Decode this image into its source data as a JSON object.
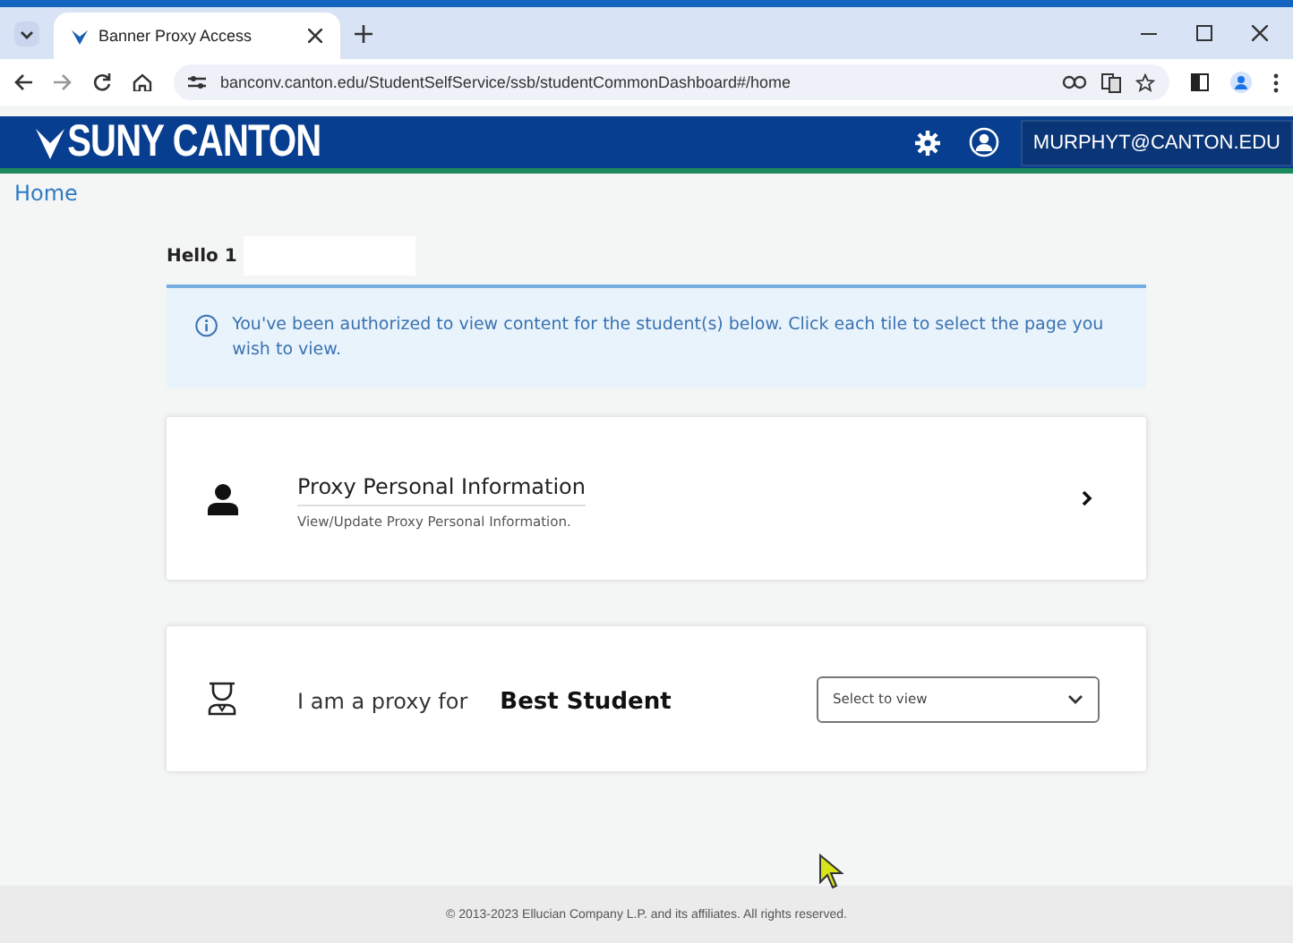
{
  "browser": {
    "tabs": [
      {
        "title": "Banner Proxy Access",
        "selected": true
      }
    ],
    "url": "banconv.canton.edu/StudentSelfService/ssb/studentCommonDashboard#/home"
  },
  "header": {
    "logo": "SUNY CANTON",
    "user": "MURPHYT@CANTON.EDU"
  },
  "breadcrumb": "Home",
  "greeting": "Hello 1",
  "notice": "You've been authorized to view content for the student(s) below. Click each tile to select the page you wish to view.",
  "tiles": [
    {
      "kind": "link",
      "title": "Proxy Personal Information",
      "description": "View/Update Proxy Personal Information."
    },
    {
      "kind": "proxy",
      "label": "I am a proxy for",
      "student": "Best Student",
      "select": {
        "placeholder": "Select to view"
      }
    }
  ],
  "footer": "© 2013-2023 Ellucian Company L.P. and its affiliates. All rights reserved."
}
